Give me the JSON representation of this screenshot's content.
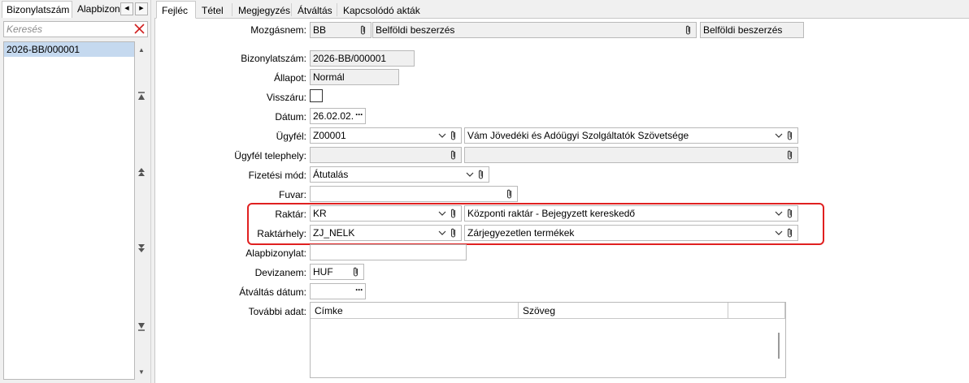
{
  "left_panel": {
    "tabs": [
      "Bizonylatszám",
      "Alapbizon"
    ],
    "search_placeholder": "Keresés",
    "items": [
      "2026-BB/000001"
    ]
  },
  "tabs": [
    "Fejléc",
    "Tétel",
    "Megjegyzés",
    "Átváltás",
    "Kapcsolódó akták"
  ],
  "form": {
    "mozgasnem": {
      "label": "Mozgásnem:",
      "code": "BB",
      "name": "Belföldi beszerzés",
      "extra": "Belföldi beszerzés"
    },
    "bizonylatszam": {
      "label": "Bizonylatszám:",
      "value": "2026-BB/000001"
    },
    "allapot": {
      "label": "Állapot:",
      "value": "Normál"
    },
    "visszaru": {
      "label": "Visszáru:",
      "checked": false
    },
    "datum": {
      "label": "Dátum:",
      "value": "26.02.02."
    },
    "ugyfel": {
      "label": "Ügyfél:",
      "code": "Z00001",
      "name": "Vám Jövedéki és Adóügyi Szolgáltatók Szövetsége"
    },
    "ugyfel_telephely": {
      "label": "Ügyfél telephely:",
      "code": "",
      "name": ""
    },
    "fizetesi_mod": {
      "label": "Fizetési mód:",
      "value": "Átutalás"
    },
    "fuvar": {
      "label": "Fuvar:",
      "value": ""
    },
    "raktar": {
      "label": "Raktár:",
      "code": "KR",
      "name": "Központi raktár - Bejegyzett kereskedő"
    },
    "raktarhely": {
      "label": "Raktárhely:",
      "code": "ZJ_NELK",
      "name": "Zárjegyezetlen termékek"
    },
    "alapbizonylat": {
      "label": "Alapbizonylat:",
      "value": ""
    },
    "devizanem": {
      "label": "Devizanem:",
      "value": "HUF"
    },
    "atvaltas_datum": {
      "label": "Átváltás dátum:",
      "value": ""
    },
    "tovabbi_adat": {
      "label": "További adat:",
      "columns": [
        "Címke",
        "Szöveg"
      ]
    }
  },
  "colors": {
    "highlight": "#e02020",
    "selected_row": "#c5d9ef"
  }
}
